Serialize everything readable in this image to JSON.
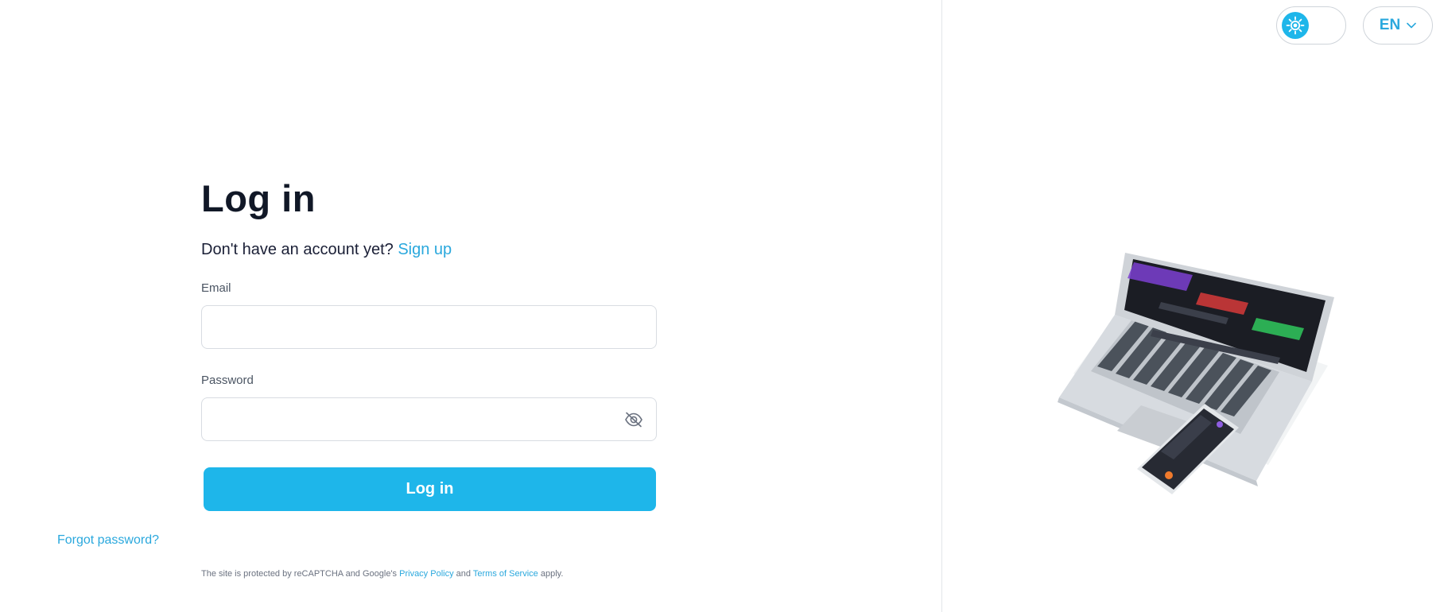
{
  "login": {
    "title": "Log in",
    "signup_prompt": "Don't have an account yet?",
    "signup_link": "Sign up",
    "email_label": "Email",
    "email_value": "",
    "password_label": "Password",
    "password_value": "",
    "submit_label": "Log in",
    "forgot_link": "Forgot password?",
    "recaptcha": {
      "prefix": "The site is protected by reCAPTCHA and Google's",
      "privacy_link": "Privacy Policy",
      "and_text": "and",
      "terms_link": "Terms of Service",
      "suffix": "apply."
    }
  },
  "header": {
    "theme_icon": "sun-icon",
    "language_code": "EN",
    "language_icon": "chevron-down-icon"
  },
  "colors": {
    "accent": "#1eb6ea",
    "link": "#2aa8dd",
    "title": "#111827"
  }
}
